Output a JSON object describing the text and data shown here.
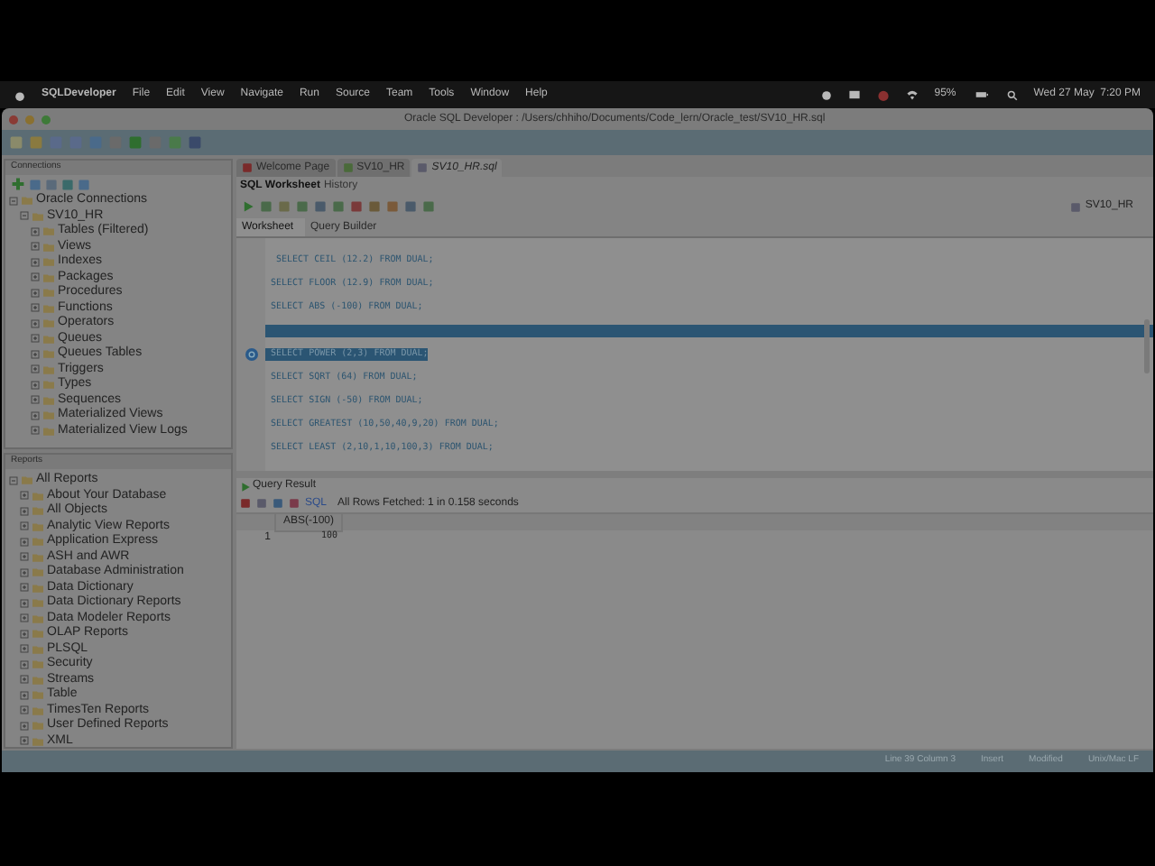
{
  "menu_bar": {
    "app": "SQLDeveloper",
    "items": [
      "File",
      "Edit",
      "View",
      "Navigate",
      "Run",
      "Source",
      "Team",
      "Tools",
      "Window",
      "Help"
    ],
    "battery": "95%",
    "clock": "Wed 27 May  7:20 PM"
  },
  "window": {
    "title": "Oracle SQL Developer : /Users/chhiho/Documents/Code_lern/Oracle_test/SV10_HR.sql"
  },
  "connections_panel": {
    "title": "Connections",
    "tree": [
      {
        "label": "Oracle Connections",
        "expanded": true,
        "children": [
          {
            "label": "SV10_HR",
            "expanded": true,
            "children": [
              {
                "label": "Tables (Filtered)",
                "expanded": false
              },
              {
                "label": "Views",
                "expanded": false
              },
              {
                "label": "Indexes",
                "expanded": false
              },
              {
                "label": "Packages",
                "expanded": false
              },
              {
                "label": "Procedures",
                "expanded": false
              },
              {
                "label": "Functions",
                "expanded": false
              },
              {
                "label": "Operators",
                "expanded": false
              },
              {
                "label": "Queues",
                "expanded": false
              },
              {
                "label": "Queues Tables",
                "expanded": false
              },
              {
                "label": "Triggers",
                "expanded": false
              },
              {
                "label": "Types",
                "expanded": false
              },
              {
                "label": "Sequences",
                "expanded": false
              },
              {
                "label": "Materialized Views",
                "expanded": false
              },
              {
                "label": "Materialized View Logs",
                "expanded": false
              }
            ]
          }
        ]
      }
    ]
  },
  "reports_panel": {
    "title": "Reports",
    "tree": [
      {
        "label": "All Reports",
        "expanded": true,
        "children": [
          {
            "label": "About Your Database",
            "expanded": false
          },
          {
            "label": "All Objects",
            "expanded": false
          },
          {
            "label": "Analytic View Reports",
            "expanded": false
          },
          {
            "label": "Application Express",
            "expanded": false
          },
          {
            "label": "ASH and AWR",
            "expanded": false
          },
          {
            "label": "Database Administration",
            "expanded": false
          },
          {
            "label": "Data Dictionary",
            "expanded": false
          },
          {
            "label": "Data Dictionary Reports",
            "expanded": false
          },
          {
            "label": "Data Modeler Reports",
            "expanded": false
          },
          {
            "label": "OLAP Reports",
            "expanded": false
          },
          {
            "label": "PLSQL",
            "expanded": false
          },
          {
            "label": "Security",
            "expanded": false
          },
          {
            "label": "Streams",
            "expanded": false
          },
          {
            "label": "Table",
            "expanded": false
          },
          {
            "label": "TimesTen Reports",
            "expanded": false
          },
          {
            "label": "User Defined Reports",
            "expanded": false
          },
          {
            "label": "XML",
            "expanded": false
          }
        ]
      }
    ]
  },
  "document_tabs": [
    {
      "label": "Welcome Page",
      "selected": false
    },
    {
      "label": "SV10_HR",
      "selected": false
    },
    {
      "label": "SV10_HR.sql",
      "selected": true
    }
  ],
  "worksheet_tabs": [
    {
      "label": "SQL Worksheet",
      "selected": true
    },
    {
      "label": "History",
      "selected": false
    }
  ],
  "connection_selector": "SV10_HR",
  "editor_tabs": [
    {
      "label": "Worksheet",
      "selected": true
    },
    {
      "label": "Query Builder",
      "selected": false
    }
  ],
  "code_lines": [
    {
      "kind": "code",
      "text": " SELECT CEIL (12.2) FROM DUAL;",
      "selected": false
    },
    {
      "kind": "code",
      "text": "SELECT FLOOR (12.9) FROM DUAL;",
      "selected": false
    },
    {
      "kind": "code",
      "text": "SELECT ABS (-100) FROM DUAL;",
      "selected": false
    },
    {
      "kind": "cursor"
    },
    {
      "kind": "code",
      "text": "SELECT POWER (2,3) FROM DUAL;",
      "selected": true
    },
    {
      "kind": "code",
      "text": "SELECT SQRT (64) FROM DUAL;",
      "selected": false
    },
    {
      "kind": "code",
      "text": "SELECT SIGN (-50) FROM DUAL;",
      "selected": false
    },
    {
      "kind": "code",
      "text": "SELECT GREATEST (10,50,40,9,20) FROM DUAL;",
      "selected": false
    },
    {
      "kind": "code",
      "text": "SELECT LEAST (2,10,1,10,100,3) FROM DUAL;",
      "selected": false
    }
  ],
  "query_result": {
    "tab": "Query Result",
    "sql_link": "SQL",
    "message": "All Rows Fetched: 1 in 0.158 seconds",
    "columns": [
      "ABS(-100)"
    ],
    "rows": [
      {
        "number": "1",
        "cells": [
          "100"
        ]
      }
    ]
  },
  "status_bar": [
    "Line 39 Column 3",
    "Insert",
    "Modified",
    "Unix/Mac LF"
  ]
}
